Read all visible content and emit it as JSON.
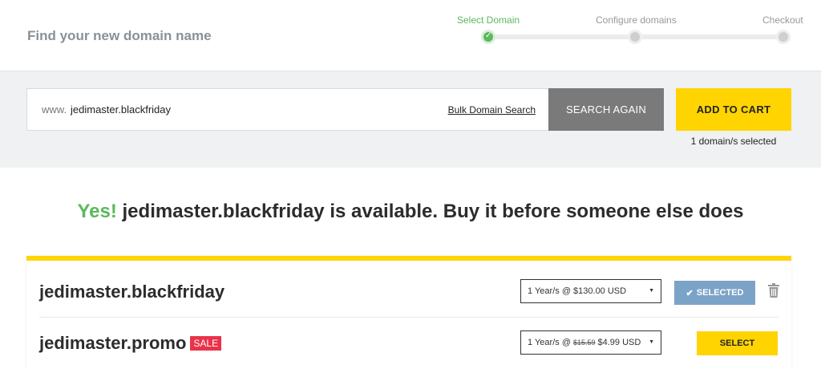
{
  "header": {
    "title": "Find your new domain name",
    "steps": [
      {
        "label": "Select Domain",
        "state": "done"
      },
      {
        "label": "Configure domains",
        "state": "pending"
      },
      {
        "label": "Checkout",
        "state": "pending"
      }
    ]
  },
  "search": {
    "prefix": "www.",
    "value": "jedimaster.blackfriday",
    "bulk_link": "Bulk Domain Search",
    "search_again_label": "SEARCH AGAIN",
    "add_to_cart_label": "ADD TO CART",
    "selected_count": "1 domain/s selected"
  },
  "headline": {
    "yes": "Yes!",
    "text": "jedimaster.blackfriday is available. Buy it before someone else does"
  },
  "results": [
    {
      "domain": "jedimaster.blackfriday",
      "price_text": "1 Year/s @ $130.00 USD",
      "button_label": "SELECTED",
      "button_state": "selected"
    },
    {
      "domain": "jedimaster.promo",
      "badge": "SALE",
      "price_prefix": "1 Year/s @",
      "price_old": "$15.59",
      "price_new": "$4.99 USD",
      "button_label": "SELECT",
      "button_state": "select"
    }
  ],
  "colors": {
    "accent_yellow": "#ffd400",
    "success_green": "#5cb85c",
    "selected_blue": "#7ba3c7",
    "sale_red": "#e8334a"
  }
}
